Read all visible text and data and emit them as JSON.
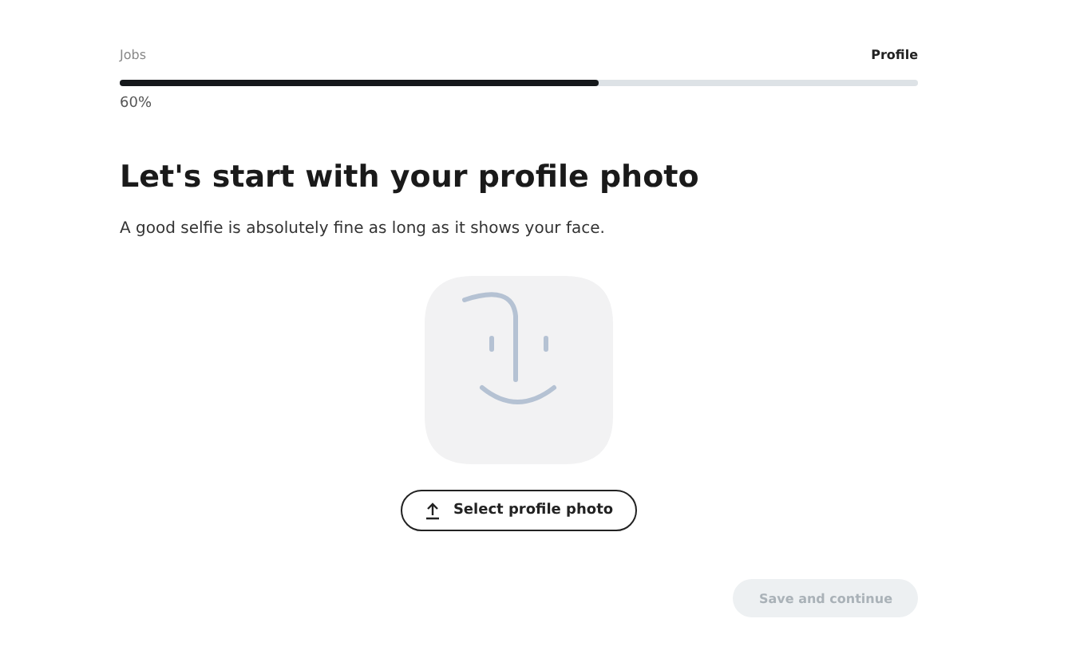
{
  "progress": {
    "start_label": "Jobs",
    "end_label": "Profile",
    "level": 0.6,
    "reading": "60%"
  },
  "heading": "Let's start with your profile photo",
  "subtitle": "A good selfie is absolutely fine as long as it shows your face.",
  "upload_button": {
    "label": "Select profile photo"
  },
  "save_button": {
    "label": "Save and continue",
    "disabled": true
  }
}
